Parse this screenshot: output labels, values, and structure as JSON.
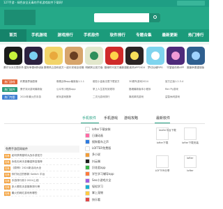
{
  "topbar": {
    "notice": "127手游 - 绿色安全无毒的手机游戏软件下载网!"
  },
  "nav": {
    "items": [
      "首页",
      "手机游戏",
      "游戏排行",
      "手机软件",
      "软件排行",
      "专题合集",
      "最新更新",
      "热门排行"
    ]
  },
  "apps": [
    {
      "name": "蛋仔派对无限秒杀",
      "color": "#1b1b1b",
      "accent": "#c7f33c"
    },
    {
      "name": "星际争霸II移动版",
      "color": "#2c2140",
      "accent": "#7bd1f2"
    },
    {
      "name": "赛博风云游戏官方",
      "color": "#f2d46a",
      "accent": "#e9a93d"
    },
    {
      "name": "一起长安城全攻略",
      "color": "#d7a56c",
      "accent": "#6a3f22"
    },
    {
      "name": "明朝风云官方版",
      "color": "#e2e7cc",
      "accent": "#2f8f5b"
    },
    {
      "name": "猎魂时代官方最新",
      "color": "#cf2a2a",
      "accent": "#ffd24a"
    },
    {
      "name": "魔影疾风APP2024",
      "color": "#2a2424",
      "accent": "#f8e05a"
    },
    {
      "name": "梦幻仙域RPG",
      "color": "#7fd4ee",
      "accent": "#ffffff"
    },
    {
      "name": "守望者传奇APP",
      "color": "#4e2a7a",
      "accent": "#f09ad6"
    },
    {
      "name": "魔兽争霸重制版",
      "color": "#2f5f8f",
      "accent": "#9fd3ff"
    }
  ],
  "link_rows": [
    {
      "tag": "热门游戏",
      "tag_color": "#e3693c",
      "links": [
        "积累魔界面剧情",
        "像素战争app最新版1.1.1",
        "烟花小金鱼无限下载官方",
        "3D赛车游戏2024",
        "官方正版1.2.3.4",
        "grindr apk",
        "星际战场玩法",
        "小Kitty安装最新版"
      ]
    },
    {
      "tag": "热门软件",
      "tag_color": "#2b9d7c",
      "links": [
        "蛋仔派对游戏最新版",
        "公众号小程序app",
        "掌上人生发布到现场",
        "猎魂最新版本小程序",
        "Ren'Py游戏",
        "超级VPN",
        "鲤鱼小说",
        "安卓软件合集"
      ]
    },
    {
      "tag": "热门专题",
      "tag_color": "#3f7fd1",
      "links": [
        "2024年最火的手游",
        "耐玩游戏推荐",
        "二次元游戏排行",
        "离线单机游戏",
        "益智休闲游戏",
        "网络用语大全",
        "动作格斗",
        "免费影视APP"
      ]
    }
  ],
  "panel": {
    "tabs": [
      "手机软件",
      "手机游戏",
      "游戏攻略"
    ],
    "side_title": "最新软件",
    "left_head": "免费手游官网软件",
    "left_rows": [
      {
        "tag": "攻略",
        "text": "如何获得星球大战手游官方"
      },
      {
        "tag": "攻略",
        "text": "永劫无间手游最强阵容推荐"
      },
      {
        "tag": "攻略",
        "text": "《原神》2024新活动大全"
      },
      {
        "tag": "攻略",
        "text": "你们玩过的那款 Switch 平台"
      },
      {
        "tag": "攻略",
        "text": "手游排行前十2024上线"
      },
      {
        "tag": "攻略",
        "text": "多人联机手游推荐排行榜"
      },
      {
        "tag": "攻略",
        "text": "最火的网红游戏有哪些"
      }
    ],
    "mid_rows": [
      {
        "name": "lofter下载安装",
        "color": "#ffffff"
      },
      {
        "name": "日漫动画",
        "color": "#ff6aa5"
      },
      {
        "name": "搜狗看车之声",
        "color": "#2e7be0"
      },
      {
        "name": "LOFTER免费版",
        "color": "#ffffff"
      },
      {
        "name": "多小说",
        "color": "#f29d38"
      },
      {
        "name": "抖云端",
        "color": "#1f1f1f"
      },
      {
        "name": "识花君app",
        "color": "#3bb54a"
      },
      {
        "name": "学生学习辅导app",
        "color": "#ff7a3d"
      },
      {
        "name": "Seo小游戏大全",
        "color": "#a05ee0"
      },
      {
        "name": "轻松学习",
        "color": "#18b0d0"
      },
      {
        "name": "掌上宠物",
        "color": "#ffcb42"
      },
      {
        "name": "快乐看",
        "color": "#e04848"
      }
    ],
    "grid": [
      {
        "name": "lofter下载"
      },
      {
        "name": "lofter下载安装"
      },
      {
        "name": "LOFTER分享"
      },
      {
        "name": "lofter"
      }
    ],
    "grid_alt": [
      "leofer平台下载",
      "lofter"
    ]
  }
}
